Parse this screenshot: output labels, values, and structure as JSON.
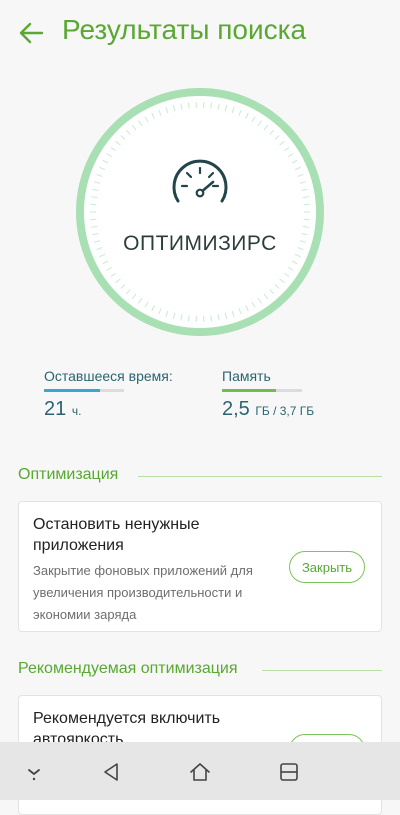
{
  "header": {
    "title": "Результаты поиска"
  },
  "dial": {
    "label": "ОПТИМИЗИРС"
  },
  "stats": {
    "time": {
      "label": "Оставшееся время:",
      "value": "21",
      "unit": "ч.",
      "bar_fraction": 0.7,
      "bar_color": "#3aa6d8"
    },
    "memory": {
      "label": "Память",
      "value": "2,5",
      "unit": "ГБ / 3,7 ГБ",
      "bar_fraction": 0.67,
      "bar_color": "#6cc04a"
    }
  },
  "sections": {
    "optimization": {
      "title": "Оптимизация",
      "card": {
        "title": "Остановить ненужные приложения",
        "description": "Закрытие фоновых приложений для увеличения производительности и экономии заряда",
        "button": "Закрыть"
      }
    },
    "recommended": {
      "title": "Рекомендуемая оптимизация",
      "card": {
        "title": "Рекомендуется включить автояркость"
      }
    }
  },
  "colors": {
    "accent": "#58a832",
    "ring": "#a8e0b4",
    "text_teal": "#2b6470"
  },
  "icons": {
    "back": "arrow-left-icon",
    "speedometer": "speedometer-icon",
    "nav": [
      "chevron-down-icon",
      "back-triangle-icon",
      "home-icon",
      "recents-icon"
    ]
  }
}
